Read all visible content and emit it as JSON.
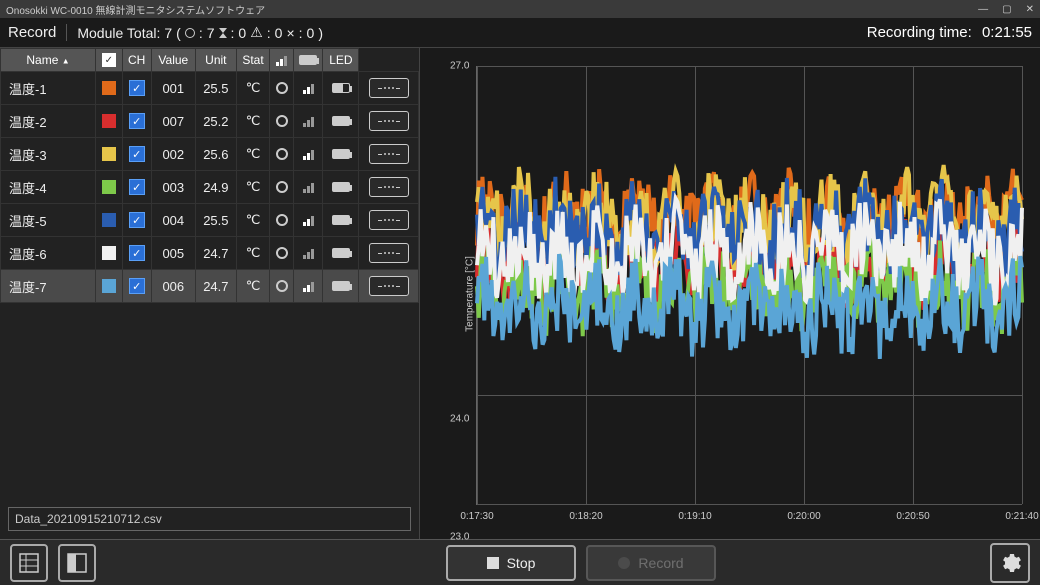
{
  "window": {
    "title": "Onosokki WC-0010 無線計測モニタシステムソフトウェア"
  },
  "topbar": {
    "record_label": "Record",
    "module_total_prefix": "Module Total:",
    "module_total_count": "7",
    "status_ok": "7",
    "status_wait": "0",
    "status_warn": "0",
    "status_err": "0",
    "rectime_label": "Recording time:",
    "rectime_value": "0:21:55"
  },
  "table": {
    "headers": {
      "name": "Name",
      "check": "✓",
      "ch": "CH",
      "value": "Value",
      "unit": "Unit",
      "stat": "Stat",
      "signal": "",
      "batt": "",
      "led": "LED"
    },
    "rows": [
      {
        "name": "温度-1",
        "color": "#e06a1a",
        "ch": "001",
        "value": "25.5",
        "unit": "℃",
        "selected": false
      },
      {
        "name": "温度-2",
        "color": "#d82e2e",
        "ch": "007",
        "value": "25.2",
        "unit": "℃",
        "selected": false
      },
      {
        "name": "温度-3",
        "color": "#e6c54a",
        "ch": "002",
        "value": "25.6",
        "unit": "℃",
        "selected": false
      },
      {
        "name": "温度-4",
        "color": "#7ec94a",
        "ch": "003",
        "value": "24.9",
        "unit": "℃",
        "selected": false
      },
      {
        "name": "温度-5",
        "color": "#2a5db0",
        "ch": "004",
        "value": "25.5",
        "unit": "℃",
        "selected": false
      },
      {
        "name": "温度-6",
        "color": "#f0f0f0",
        "ch": "005",
        "value": "24.7",
        "unit": "℃",
        "selected": false
      },
      {
        "name": "温度-7",
        "color": "#5aa5d6",
        "ch": "006",
        "value": "24.7",
        "unit": "℃",
        "selected": true
      }
    ]
  },
  "file": {
    "name": "Data_20210915210712.csv"
  },
  "buttons": {
    "stop": "Stop",
    "record": "Record"
  },
  "chart_data": {
    "type": "line",
    "ylabel": "Temperature [°C]",
    "ylim": [
      23.0,
      27.0
    ],
    "yticks": [
      23.0,
      24.0,
      27.0
    ],
    "xticks": [
      "0:17:30",
      "0:18:20",
      "0:19:10",
      "0:20:00",
      "0:20:50",
      "0:21:40"
    ],
    "series": [
      {
        "name": "温度-1",
        "color": "#e06a1a",
        "approx_mean": 25.6
      },
      {
        "name": "温度-2",
        "color": "#d82e2e",
        "approx_mean": 25.2
      },
      {
        "name": "温度-3",
        "color": "#e6c54a",
        "approx_mean": 25.6
      },
      {
        "name": "温度-4",
        "color": "#7ec94a",
        "approx_mean": 25.0
      },
      {
        "name": "温度-5",
        "color": "#2a5db0",
        "approx_mean": 25.5
      },
      {
        "name": "温度-6",
        "color": "#f0f0f0",
        "approx_mean": 25.3
      },
      {
        "name": "温度-7",
        "color": "#5aa5d6",
        "approx_mean": 24.8
      }
    ]
  }
}
